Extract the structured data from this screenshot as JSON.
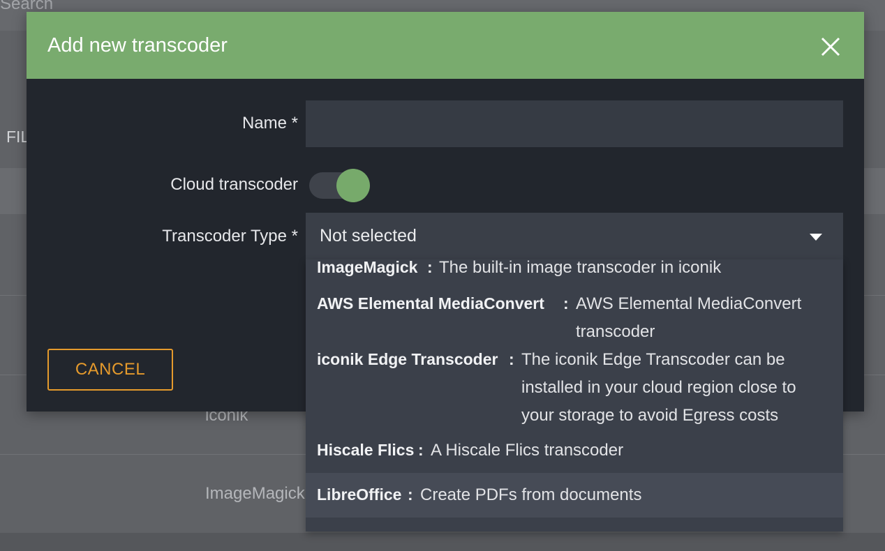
{
  "background": {
    "search_label": "Search",
    "side_label": "FIL",
    "rows": [
      "iconik",
      "ImageMagick"
    ]
  },
  "modal": {
    "title": "Add new transcoder",
    "fields": {
      "name_label": "Name *",
      "name_value": "",
      "cloud_label": "Cloud transcoder",
      "cloud_enabled": true,
      "type_label": "Transcoder Type *",
      "type_selected": "Not selected"
    },
    "cancel_label": "CANCEL"
  },
  "dropdown": {
    "options": [
      {
        "name": "ImageMagick",
        "sep": ":",
        "desc_lines": [
          "The built-in image transcoder in iconik"
        ]
      },
      {
        "name": "AWS Elemental MediaConvert",
        "sep": ":",
        "desc_lines": [
          "AWS Elemental MediaConvert",
          "transcoder"
        ]
      },
      {
        "name": "iconik Edge Transcoder",
        "sep": ":",
        "desc_lines": [
          "The iconik Edge Transcoder can be",
          "installed in your cloud region close to",
          "your storage to avoid Egress costs"
        ]
      },
      {
        "name": "Hiscale Flics",
        "sep": ":",
        "desc_lines": [
          "A Hiscale Flics transcoder"
        ]
      },
      {
        "name": "LibreOffice",
        "sep": ":",
        "desc_lines": [
          "Create PDFs from documents"
        ]
      }
    ],
    "highlighted_index": 4
  },
  "colors": {
    "header_green": "#79ab6e",
    "accent_orange": "#e59a2c",
    "modal_bg": "#22262d"
  }
}
